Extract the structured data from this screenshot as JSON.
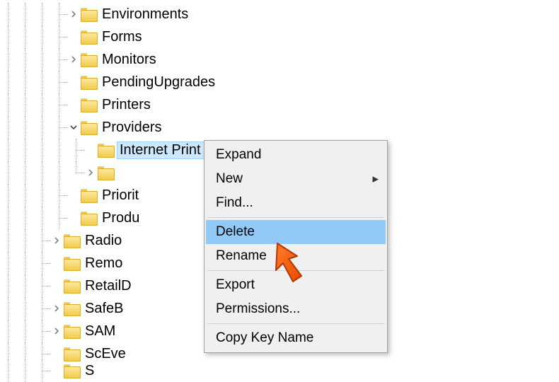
{
  "tree": {
    "items": [
      {
        "label": "Environments",
        "expandable": true,
        "expanded": false,
        "level": 6
      },
      {
        "label": "Forms",
        "expandable": false,
        "level": 6,
        "last": false
      },
      {
        "label": "Monitors",
        "expandable": true,
        "expanded": false,
        "level": 6
      },
      {
        "label": "PendingUpgrades",
        "expandable": false,
        "level": 6
      },
      {
        "label": "Printers",
        "expandable": false,
        "level": 6
      },
      {
        "label": "Providers",
        "expandable": true,
        "expanded": true,
        "level": 6
      },
      {
        "label": "Internet Print Provider",
        "expandable": false,
        "level": 7,
        "selected": true
      },
      {
        "label": "",
        "expandable": true,
        "expanded": false,
        "level": 7,
        "last": true
      },
      {
        "label": "PriorityControl",
        "expandable": false,
        "level": 6,
        "clip": "Priorit"
      },
      {
        "label": "ProductOptions",
        "expandable": false,
        "level": 6,
        "clip": "Produ"
      },
      {
        "label": "RadioManagement",
        "expandable": true,
        "expanded": false,
        "level": 5,
        "clip": "Radio"
      },
      {
        "label": "RemoteAccess",
        "expandable": false,
        "level": 5,
        "clip": "Remo"
      },
      {
        "label": "RetailDemo",
        "expandable": false,
        "level": 5,
        "clip": "RetailD"
      },
      {
        "label": "SafeBoot",
        "expandable": true,
        "expanded": false,
        "level": 5,
        "clip": "SafeB"
      },
      {
        "label": "SAM",
        "expandable": true,
        "expanded": false,
        "level": 5,
        "clip": "SAM"
      },
      {
        "label": "ScEvents",
        "expandable": false,
        "level": 5,
        "clip": "ScEve"
      },
      {
        "label": "ScsiPort",
        "expandable": false,
        "level": 5,
        "clip": "S",
        "cut": true
      }
    ]
  },
  "contextMenu": {
    "items": [
      {
        "label": "Expand"
      },
      {
        "label": "New",
        "submenu": true
      },
      {
        "label": "Find..."
      },
      {
        "sep": true
      },
      {
        "label": "Delete",
        "highlighted": true
      },
      {
        "label": "Rename"
      },
      {
        "sep": true
      },
      {
        "label": "Export"
      },
      {
        "label": "Permissions..."
      },
      {
        "sep": true
      },
      {
        "label": "Copy Key Name"
      }
    ]
  }
}
